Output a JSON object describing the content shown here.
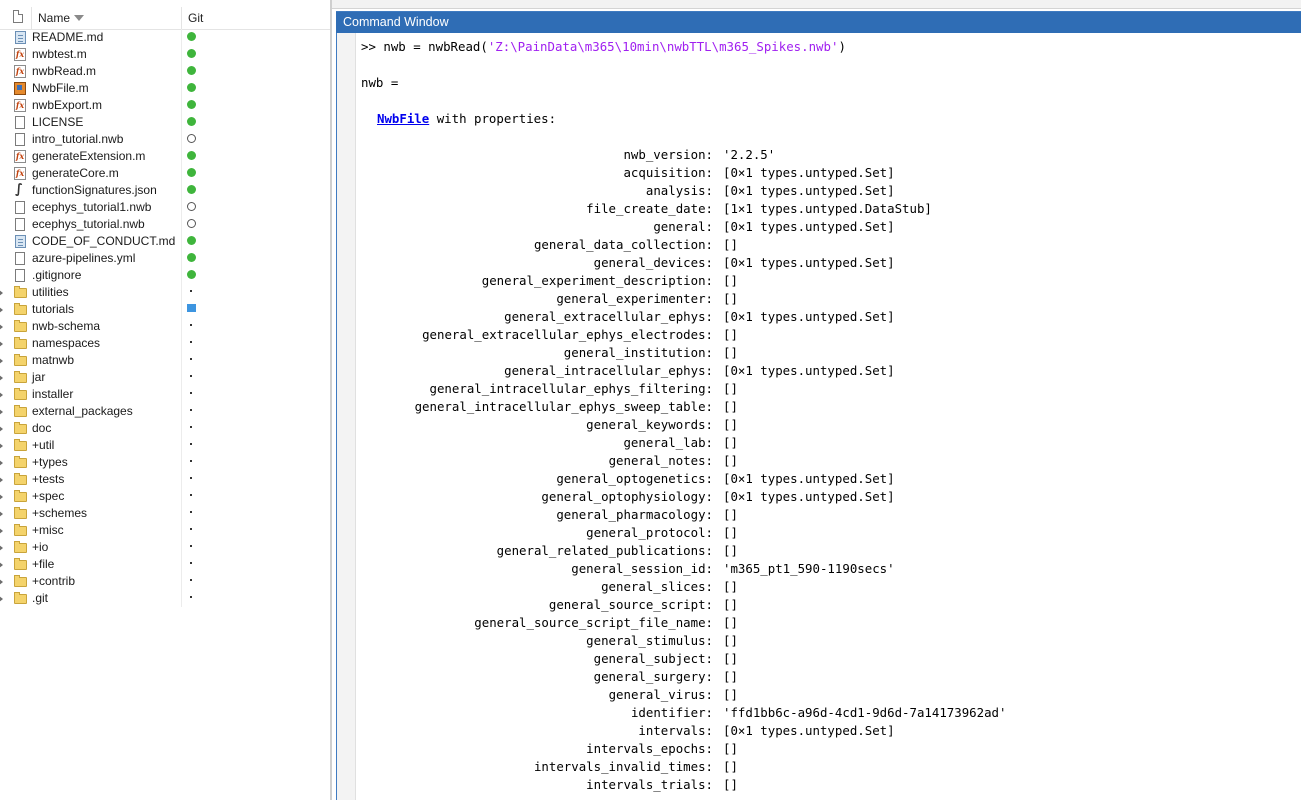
{
  "file_browser": {
    "columns": {
      "name": "Name",
      "git": "Git"
    },
    "files": [
      {
        "name": "README.md",
        "icon": "markdown-icon",
        "status": "green"
      },
      {
        "name": "nwbtest.m",
        "icon": "function-icon",
        "status": "green"
      },
      {
        "name": "nwbRead.m",
        "icon": "function-icon",
        "status": "green"
      },
      {
        "name": "NwbFile.m",
        "icon": "class-icon",
        "status": "green"
      },
      {
        "name": "nwbExport.m",
        "icon": "function-icon",
        "status": "green"
      },
      {
        "name": "LICENSE",
        "icon": "file-icon",
        "status": "green"
      },
      {
        "name": "intro_tutorial.nwb",
        "icon": "file-icon",
        "status": "empty"
      },
      {
        "name": "generateExtension.m",
        "icon": "function-icon",
        "status": "green"
      },
      {
        "name": "generateCore.m",
        "icon": "function-icon",
        "status": "green"
      },
      {
        "name": "functionSignatures.json",
        "icon": "json-icon",
        "status": "green"
      },
      {
        "name": "ecephys_tutorial1.nwb",
        "icon": "file-icon",
        "status": "empty"
      },
      {
        "name": "ecephys_tutorial.nwb",
        "icon": "file-icon",
        "status": "empty"
      },
      {
        "name": "CODE_OF_CONDUCT.md",
        "icon": "markdown-icon",
        "status": "green"
      },
      {
        "name": "azure-pipelines.yml",
        "icon": "file-icon",
        "status": "green"
      },
      {
        "name": ".gitignore",
        "icon": "file-icon",
        "status": "green"
      },
      {
        "name": "utilities",
        "icon": "folder-icon",
        "status": "dot",
        "expandable": true
      },
      {
        "name": "tutorials",
        "icon": "folder-icon",
        "status": "blue",
        "expandable": true
      },
      {
        "name": "nwb-schema",
        "icon": "folder-icon",
        "status": "dot",
        "expandable": true
      },
      {
        "name": "namespaces",
        "icon": "folder-icon",
        "status": "dot",
        "expandable": true
      },
      {
        "name": "matnwb",
        "icon": "folder-icon",
        "status": "dot",
        "expandable": true
      },
      {
        "name": "jar",
        "icon": "folder-icon",
        "status": "dot",
        "expandable": true
      },
      {
        "name": "installer",
        "icon": "folder-icon",
        "status": "dot",
        "expandable": true
      },
      {
        "name": "external_packages",
        "icon": "folder-icon",
        "status": "dot",
        "expandable": true
      },
      {
        "name": "doc",
        "icon": "folder-icon",
        "status": "dot",
        "expandable": true
      },
      {
        "name": "+util",
        "icon": "folder-icon",
        "status": "dot",
        "expandable": true
      },
      {
        "name": "+types",
        "icon": "folder-icon",
        "status": "dot",
        "expandable": true
      },
      {
        "name": "+tests",
        "icon": "folder-icon",
        "status": "dot",
        "expandable": true
      },
      {
        "name": "+spec",
        "icon": "folder-icon",
        "status": "dot",
        "expandable": true
      },
      {
        "name": "+schemes",
        "icon": "folder-icon",
        "status": "dot",
        "expandable": true
      },
      {
        "name": "+misc",
        "icon": "folder-icon",
        "status": "dot",
        "expandable": true
      },
      {
        "name": "+io",
        "icon": "folder-icon",
        "status": "dot",
        "expandable": true
      },
      {
        "name": "+file",
        "icon": "folder-icon",
        "status": "dot",
        "expandable": true
      },
      {
        "name": "+contrib",
        "icon": "folder-icon",
        "status": "dot",
        "expandable": true
      },
      {
        "name": ".git",
        "icon": "folder-icon",
        "status": "dot",
        "expandable": true
      }
    ]
  },
  "command_window": {
    "title": "Command Window",
    "prompt": ">>",
    "command_prefix": "nwb = nwbRead(",
    "command_path": "'Z:\\PainData\\m365\\10min\\nwbTTL\\m365_Spikes.nwb'",
    "command_suffix": ")",
    "result_var": "nwb =",
    "class_name": "NwbFile",
    "class_suffix": "with properties:",
    "properties": [
      {
        "name": "nwb_version:",
        "value": "'2.2.5'"
      },
      {
        "name": "acquisition:",
        "value": "[0×1 types.untyped.Set]"
      },
      {
        "name": "analysis:",
        "value": "[0×1 types.untyped.Set]"
      },
      {
        "name": "file_create_date:",
        "value": "[1×1 types.untyped.DataStub]"
      },
      {
        "name": "general:",
        "value": "[0×1 types.untyped.Set]"
      },
      {
        "name": "general_data_collection:",
        "value": "[]"
      },
      {
        "name": "general_devices:",
        "value": "[0×1 types.untyped.Set]"
      },
      {
        "name": "general_experiment_description:",
        "value": "[]"
      },
      {
        "name": "general_experimenter:",
        "value": "[]"
      },
      {
        "name": "general_extracellular_ephys:",
        "value": "[0×1 types.untyped.Set]"
      },
      {
        "name": "general_extracellular_ephys_electrodes:",
        "value": "[]"
      },
      {
        "name": "general_institution:",
        "value": "[]"
      },
      {
        "name": "general_intracellular_ephys:",
        "value": "[0×1 types.untyped.Set]"
      },
      {
        "name": "general_intracellular_ephys_filtering:",
        "value": "[]"
      },
      {
        "name": "general_intracellular_ephys_sweep_table:",
        "value": "[]"
      },
      {
        "name": "general_keywords:",
        "value": "[]"
      },
      {
        "name": "general_lab:",
        "value": "[]"
      },
      {
        "name": "general_notes:",
        "value": "[]"
      },
      {
        "name": "general_optogenetics:",
        "value": "[0×1 types.untyped.Set]"
      },
      {
        "name": "general_optophysiology:",
        "value": "[0×1 types.untyped.Set]"
      },
      {
        "name": "general_pharmacology:",
        "value": "[]"
      },
      {
        "name": "general_protocol:",
        "value": "[]"
      },
      {
        "name": "general_related_publications:",
        "value": "[]"
      },
      {
        "name": "general_session_id:",
        "value": "'m365_pt1_590-1190secs'"
      },
      {
        "name": "general_slices:",
        "value": "[]"
      },
      {
        "name": "general_source_script:",
        "value": "[]"
      },
      {
        "name": "general_source_script_file_name:",
        "value": "[]"
      },
      {
        "name": "general_stimulus:",
        "value": "[]"
      },
      {
        "name": "general_subject:",
        "value": "[]"
      },
      {
        "name": "general_surgery:",
        "value": "[]"
      },
      {
        "name": "general_virus:",
        "value": "[]"
      },
      {
        "name": "identifier:",
        "value": "'ffd1bb6c-a96d-4cd1-9d6d-7a14173962ad'"
      },
      {
        "name": "intervals:",
        "value": "[0×1 types.untyped.Set]"
      },
      {
        "name": "intervals_epochs:",
        "value": "[]"
      },
      {
        "name": "intervals_invalid_times:",
        "value": "[]"
      },
      {
        "name": "intervals_trials:",
        "value": "[]"
      }
    ]
  },
  "colors": {
    "title_bar": "#2f6db5",
    "string_literal": "#a020f0",
    "link": "#0000ee",
    "git_clean": "#3fb53c",
    "git_modified": "#3d95e0"
  }
}
